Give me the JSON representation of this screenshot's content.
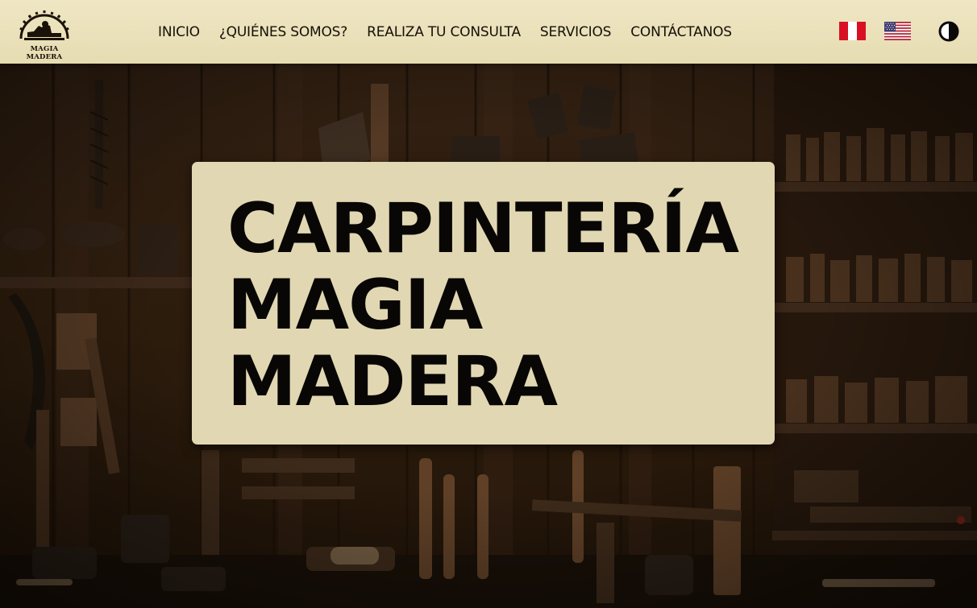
{
  "brand": {
    "logo_icon": "hand-plane-saw-blade-icon",
    "name": "MAGIA MADERA"
  },
  "nav": {
    "items": [
      {
        "label": "INICIO",
        "name": "nav-inicio"
      },
      {
        "label": "¿QUIÉNES SOMOS?",
        "name": "nav-quienes-somos"
      },
      {
        "label": "REALIZA TU CONSULTA",
        "name": "nav-realiza-consulta"
      },
      {
        "label": "SERVICIOS",
        "name": "nav-servicios"
      },
      {
        "label": "CONTÁCTANOS",
        "name": "nav-contactanos"
      }
    ]
  },
  "header_controls": {
    "language_flags": [
      "peru-flag-icon",
      "usa-flag-icon"
    ],
    "theme_toggle_icon": "half-circle-contrast-icon"
  },
  "hero": {
    "title_lines": [
      "CARPINTERÍA",
      "MAGIA",
      "MADERA"
    ],
    "background": "carpentry-workshop-tools-photo"
  },
  "colors": {
    "header_bg": "#ece3bf",
    "card_bg": "#e1d8b3",
    "text_dark": "#090705",
    "wood_dark": "#2b1d12"
  }
}
